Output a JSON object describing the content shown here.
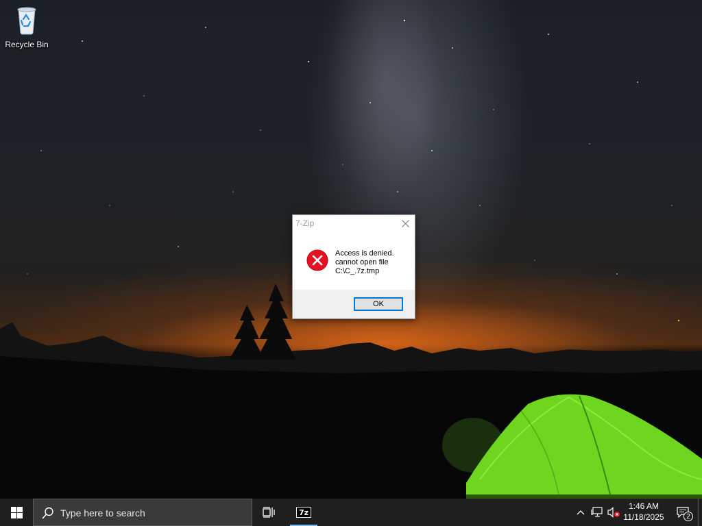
{
  "desktop": {
    "icons": [
      {
        "label": "Recycle Bin",
        "icon": "recycle-bin-icon"
      }
    ]
  },
  "dialog": {
    "title": "7-Zip",
    "message_lines": [
      "Access is denied.",
      "cannot open file",
      "C:\\C_.7z.tmp"
    ],
    "icon": "error-icon",
    "ok_label": "OK"
  },
  "taskbar": {
    "search_placeholder": "Type here to search",
    "pinned": [
      {
        "name": "task-view",
        "icon": "task-view-icon"
      },
      {
        "name": "7-zip",
        "icon": "7zip-icon",
        "label": "7z",
        "active": true
      }
    ],
    "clock": {
      "time": "1:46 AM",
      "date": "11/18/2025"
    },
    "notification_count": "2"
  },
  "colors": {
    "taskbar_bg": "#1f1f1f",
    "accent": "#0078d7",
    "error_red": "#e81123",
    "active_app_underline": "#76b9ed"
  }
}
